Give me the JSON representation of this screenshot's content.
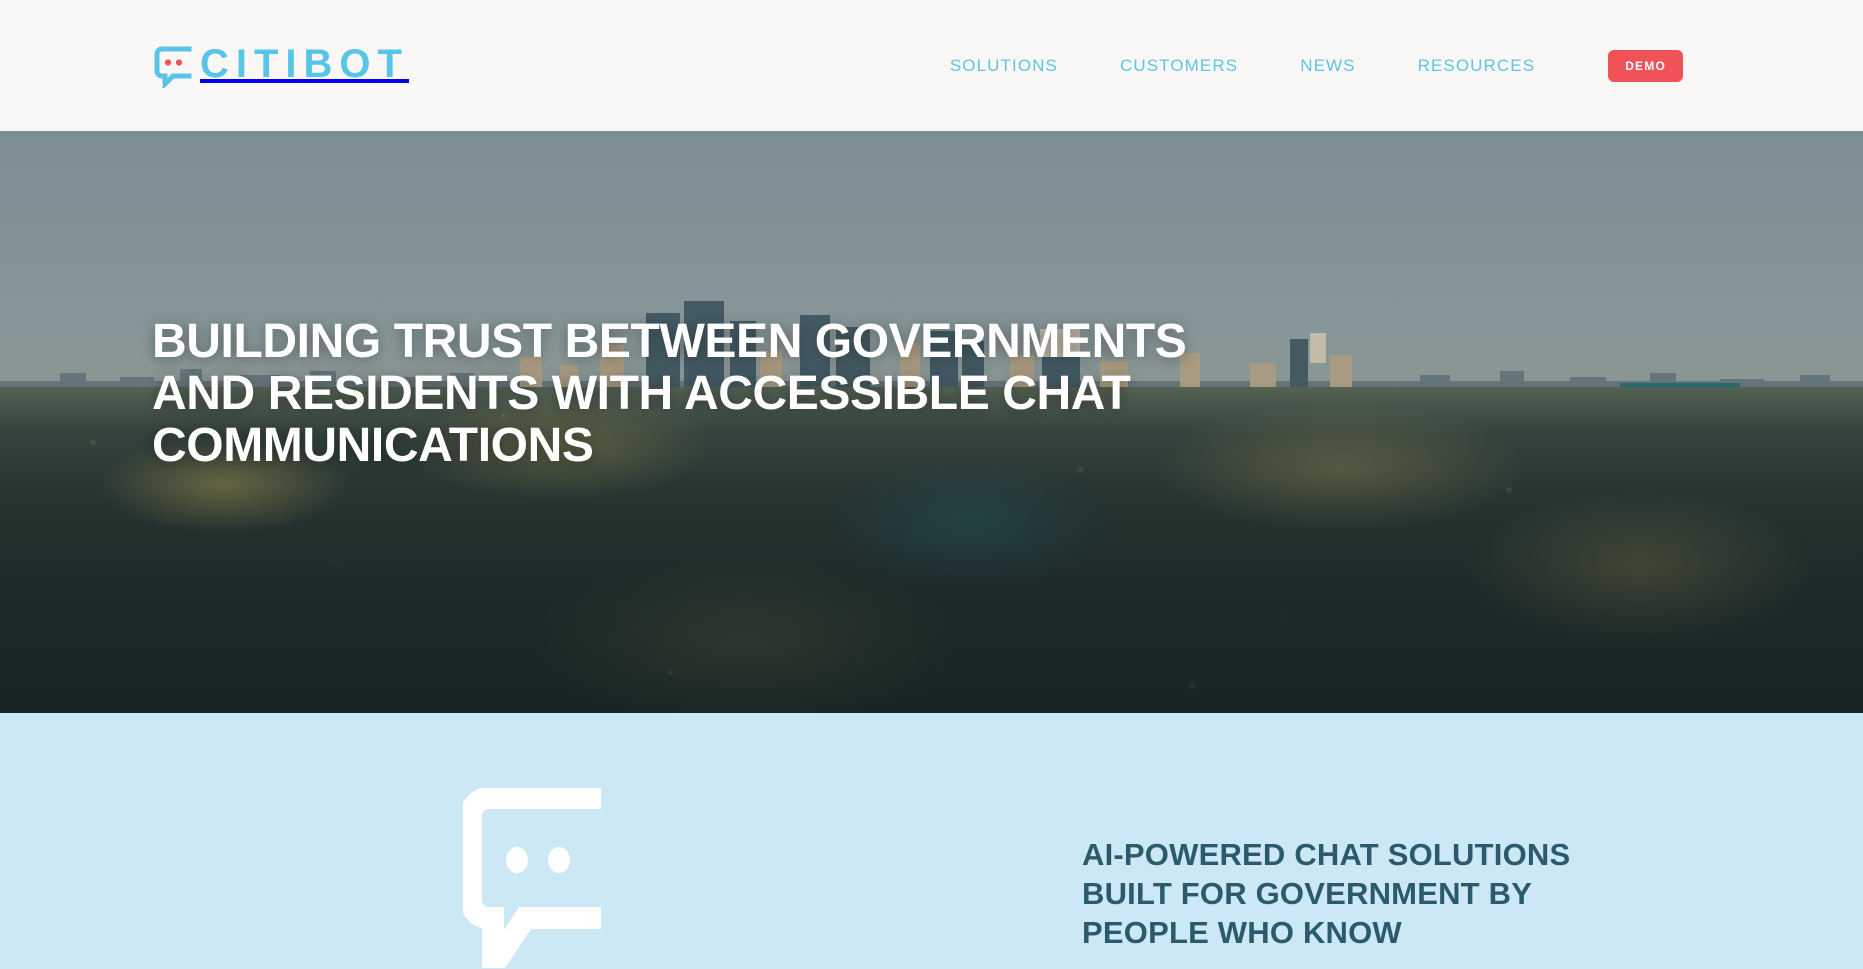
{
  "site": {
    "brand_name": "CITIBOT",
    "logo_icon": "chat-bubble-icon",
    "colors": {
      "brand_blue": "#56C5E8",
      "nav_blue": "#5EC4E2",
      "demo_red": "#EF5257",
      "header_bg": "#FAF8F6",
      "band_bg": "#CDE8F5",
      "band_heading": "#2A5A6B",
      "hero_title": "#FFFFFF",
      "logo_dots": "#EF5257"
    }
  },
  "header": {
    "nav_items": [
      {
        "label": "SOLUTIONS"
      },
      {
        "label": "CUSTOMERS"
      },
      {
        "label": "NEWS"
      },
      {
        "label": "RESOURCES"
      }
    ],
    "demo_button_label": "DEMO"
  },
  "hero": {
    "background_image": "aerial-city-skyline-over-tree-canopy",
    "title_lines": [
      "BUILDING TRUST BETWEEN GOVERNMENTS",
      "AND RESIDENTS WITH ACCESSIBLE CHAT",
      "COMMUNICATIONS"
    ],
    "title_full": "BUILDING TRUST BETWEEN GOVERNMENTS AND RESIDENTS WITH ACCESSIBLE CHAT COMMUNICATIONS"
  },
  "intro_band": {
    "icon": "chat-bubble-icon",
    "heading_lines": [
      "AI-POWERED CHAT SOLUTIONS",
      "BUILT FOR GOVERNMENT BY",
      "PEOPLE WHO KNOW"
    ],
    "heading_full": "AI-POWERED CHAT SOLUTIONS BUILT FOR GOVERNMENT BY PEOPLE WHO KNOW"
  }
}
